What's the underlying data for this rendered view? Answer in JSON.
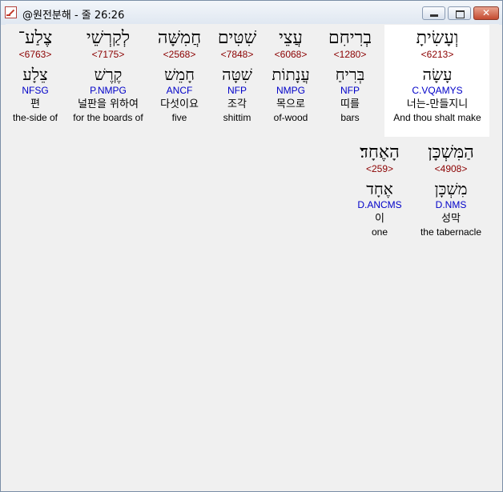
{
  "window": {
    "title": "@원전분해 - 줄 26:26",
    "controls": {
      "minimize": "minimize",
      "maximize": "maximize",
      "close": "✕"
    }
  },
  "rows": [
    {
      "words": [
        {
          "hebrew": "וְעָשִׂיתָ",
          "strong": "<6213>",
          "lemma": "עָשָׂה",
          "morph": "C.VQAMYS",
          "korean": "너는-만들지니",
          "english": "And thou shalt make",
          "highlighted": true
        },
        {
          "hebrew": "בְרִיחִם",
          "strong": "<1280>",
          "lemma": "בְּרִיחַ",
          "morph": "NFP",
          "korean": "띠를",
          "english": "bars"
        },
        {
          "hebrew": "עֲצֵי",
          "strong": "<6068>",
          "lemma": "עֲנָתוֹת",
          "morph": "NMPG",
          "korean": "목으로",
          "english": "of-wood"
        },
        {
          "hebrew": "שִׁטִּים",
          "strong": "<7848>",
          "lemma": "שִׁטָּה",
          "morph": "NFP",
          "korean": "조각",
          "english": "shittim"
        },
        {
          "hebrew": "חֲמִשָּׁה",
          "strong": "<2568>",
          "lemma": "חָמֵשׁ",
          "morph": "ANCF",
          "korean": "다섯이요",
          "english": "five"
        },
        {
          "hebrew": "לְקַרְשֵׁי",
          "strong": "<7175>",
          "lemma": "קֶרֶשׁ",
          "morph": "P.NMPG",
          "korean": "널판을 위하여",
          "english": "for the boards of"
        },
        {
          "hebrew": "צֶלַע־",
          "strong": "<6763>",
          "lemma": "צֵלָע",
          "morph": "NFSG",
          "korean": "편",
          "english": "the-side of"
        }
      ]
    },
    {
      "words": [
        {
          "hebrew": "הַמִּשְׁכָּן",
          "strong": "<4908>",
          "lemma": "מִשְׁכָּן",
          "morph": "D.NMS",
          "korean": "성막",
          "english": "the tabernacle"
        },
        {
          "hebrew": "הָאֶחָד׃",
          "strong": "<259>",
          "lemma": "אֶחָד",
          "morph": "D.ANCMS",
          "korean": "이",
          "english": "one"
        }
      ]
    }
  ]
}
